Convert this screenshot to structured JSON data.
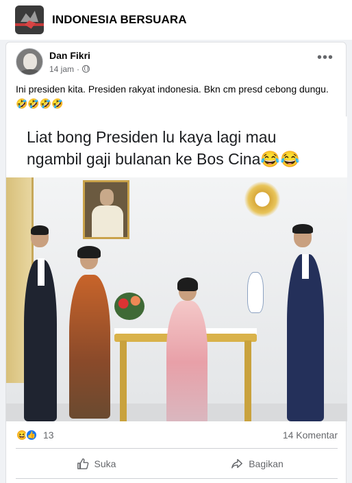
{
  "group": {
    "name": "INDONESIA BERSUARA"
  },
  "post": {
    "author": "Dan Fikri",
    "time": "14 jam",
    "separator": "·",
    "text": "Ini presiden kita. Presiden rakyat indonesia. Bkn cm presd cebong dungu. 🤣🤣🤣🤣",
    "more_icon": "more-horizontal-icon",
    "privacy_icon": "globe-icon",
    "image": {
      "caption": "Liat bong Presiden lu kaya lagi mau ngambil gaji bulanan ke Bos Cina😂😂"
    },
    "reactions": {
      "icons": [
        "haha-icon",
        "like-icon"
      ],
      "count": "13",
      "haha_glyph": "😆",
      "like_glyph": "👍"
    },
    "comments": "14 Komentar",
    "actions": {
      "like_label": "Suka",
      "share_label": "Bagikan"
    }
  },
  "colors": {
    "background": "#f0f2f5",
    "card": "#ffffff",
    "secondary_text": "#65676b",
    "like_blue": "#1877f2",
    "haha_yellow": "#f7b125"
  }
}
